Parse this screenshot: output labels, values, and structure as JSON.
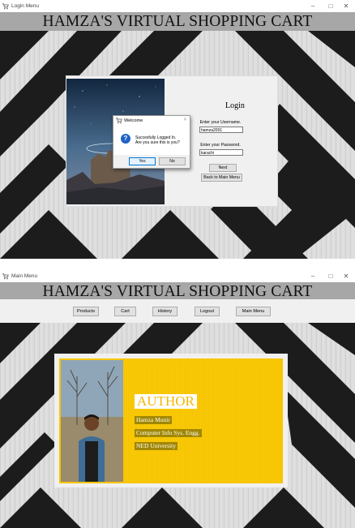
{
  "login_window": {
    "title": "Login Menu",
    "controls": {
      "minimize": "–",
      "maximize": "□",
      "close": "✕"
    },
    "banner": "HAMZA'S VIRTUAL SHOPPING CART",
    "login": {
      "title": "Login",
      "username_label": "Enter your Username.",
      "username_value": "hamza2001",
      "password_label": "Enter your Password.",
      "password_value": "karachi",
      "next_label": "Next",
      "back_label": "Back to Main Menu"
    },
    "dialog": {
      "title": "Welcome",
      "close": "✕",
      "icon": "question-icon",
      "message_line1": "Succesfully Logged In.",
      "message_line2": "Are you sure this is you?",
      "yes_label": "Yes",
      "no_label": "No"
    }
  },
  "main_window": {
    "title": "Main Menu",
    "controls": {
      "minimize": "–",
      "maximize": "□",
      "close": "✕"
    },
    "banner": "HAMZA'S VIRTUAL SHOPPING CART",
    "menu": [
      "Products",
      "Cart",
      "History",
      "Logout",
      "Main Menu"
    ],
    "author": {
      "heading": "AUTHOR",
      "name": "Hamza Munir",
      "program": "Computer Info Sys. Engg.",
      "university": "NED University"
    }
  },
  "colors": {
    "banner_bg": "#a7a7a7",
    "card_yellow": "#f7c600",
    "dialog_question": "#1e62c7"
  }
}
